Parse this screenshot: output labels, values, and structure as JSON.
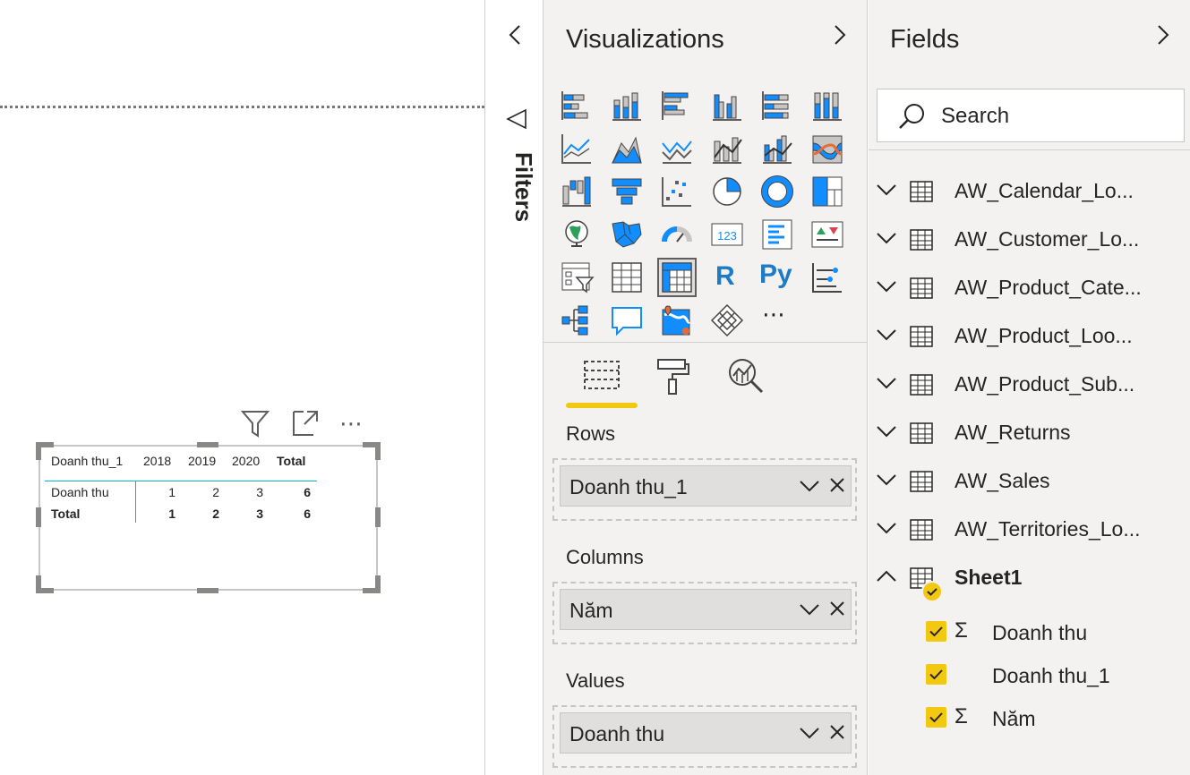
{
  "filters_pane": {
    "label": "Filters"
  },
  "visualizations_pane": {
    "title": "Visualizations",
    "icon_rows": [
      [
        "stacked-bar-chart-icon",
        "stacked-column-chart-icon",
        "clustered-bar-chart-icon",
        "clustered-column-chart-icon",
        "100-stacked-bar-chart-icon",
        "100-stacked-column-chart-icon"
      ],
      [
        "line-chart-icon",
        "area-chart-icon",
        "stacked-area-chart-icon",
        "line-and-stacked-column-chart-icon",
        "line-and-clustered-column-chart-icon",
        "ribbon-chart-icon"
      ],
      [
        "waterfall-chart-icon",
        "funnel-icon",
        "scatter-chart-icon",
        "pie-chart-icon",
        "donut-chart-icon",
        "treemap-icon"
      ],
      [
        "map-icon",
        "filled-map-icon",
        "gauge-icon",
        "card-icon",
        "multi-row-card-icon",
        "kpi-icon"
      ],
      [
        "slicer-icon",
        "table-icon",
        "matrix-icon",
        "r-visual-icon",
        "python-visual-icon",
        "key-influencers-icon"
      ],
      [
        "decomposition-tree-icon",
        "qa-icon",
        "arcgis-map-icon",
        "power-apps-icon",
        "more-visuals-icon"
      ]
    ],
    "tabs": [
      "fields-tab",
      "format-tab",
      "analytics-tab"
    ],
    "wells": [
      {
        "label": "Rows",
        "value": "Doanh thu_1"
      },
      {
        "label": "Columns",
        "value": "Năm"
      },
      {
        "label": "Values",
        "value": "Doanh thu"
      }
    ]
  },
  "fields_pane": {
    "title": "Fields",
    "search_placeholder": "Search",
    "tables": [
      "AW_Calendar_Lo...",
      "AW_Customer_Lo...",
      "AW_Product_Cate...",
      "AW_Product_Loo...",
      "AW_Product_Sub...",
      "AW_Returns",
      "AW_Sales",
      "AW_Territories_Lo..."
    ],
    "expanded_table": "Sheet1",
    "fields": [
      {
        "name": "Doanh thu",
        "sigma": "Σ",
        "checked": true
      },
      {
        "name": "Doanh thu_1",
        "sigma": "",
        "checked": true
      },
      {
        "name": "Năm",
        "sigma": "Σ",
        "checked": true
      }
    ]
  },
  "matrix": {
    "header": {
      "row_field": "Doanh thu_1",
      "cols": [
        "2018",
        "2019",
        "2020"
      ],
      "total": "Total"
    },
    "rows": [
      {
        "label": "Doanh thu",
        "values": [
          "1",
          "2",
          "3"
        ],
        "total": "6"
      }
    ],
    "total_row": {
      "label": "Total",
      "values": [
        "1",
        "2",
        "3"
      ],
      "total": "6"
    }
  },
  "colors": {
    "accent": "#f2c811",
    "teal": "#00b7c3",
    "icon_blue": "#118dff",
    "pane_bg": "#f3f2f1"
  }
}
